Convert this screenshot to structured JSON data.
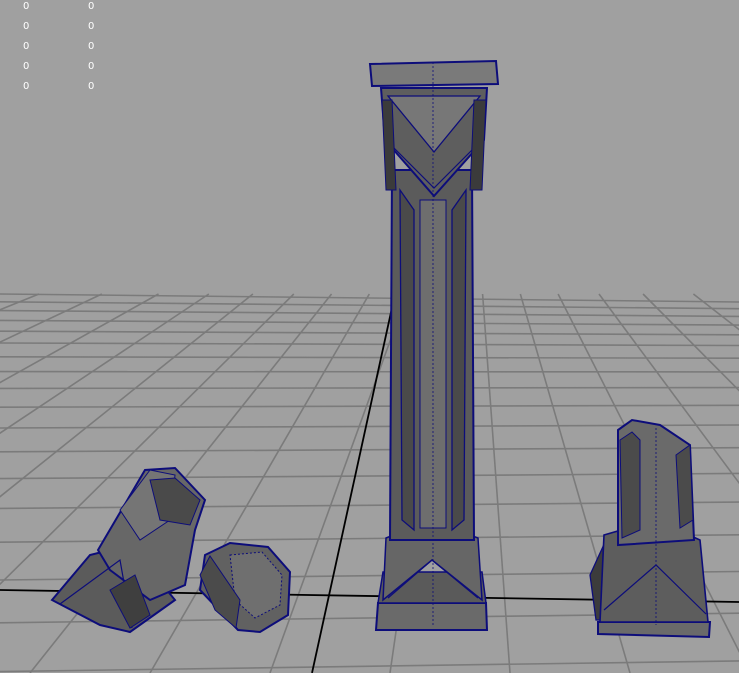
{
  "app": {
    "panel": "3D viewport (perspective)"
  },
  "hud": {
    "rows": [
      {
        "a": "0",
        "b": "0"
      },
      {
        "a": "0",
        "b": "0"
      },
      {
        "a": "0",
        "b": "0"
      },
      {
        "a": "0",
        "b": "0"
      },
      {
        "a": "0",
        "b": "0"
      }
    ]
  },
  "colors": {
    "background": "#a0a0a0",
    "grid": "#7a7a7a",
    "grid_center": "#000000",
    "mesh_fill": "#5f5f5f",
    "mesh_dark": "#3e3e3e",
    "mesh_light": "#7b7b7b",
    "selection_wire": "#0d0d7a"
  },
  "objects": [
    {
      "name": "pillar-full",
      "selected": true
    },
    {
      "name": "pillar-broken-base",
      "selected": true
    },
    {
      "name": "pillar-fragment",
      "selected": true
    },
    {
      "name": "pillar-broken-stump",
      "selected": true
    }
  ]
}
